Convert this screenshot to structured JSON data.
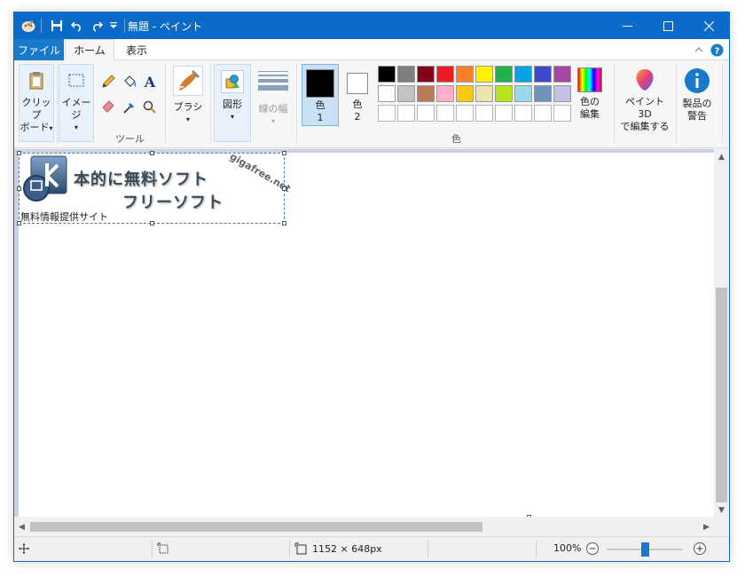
{
  "window": {
    "title": "無題 - ペイント"
  },
  "tabs": {
    "file": "ファイル",
    "home": "ホーム",
    "view": "表示"
  },
  "ribbon": {
    "clipboard": {
      "line1": "クリップ",
      "line2": "ボード"
    },
    "image": {
      "label": "イメージ"
    },
    "tools_group": "ツール",
    "brush": {
      "label": "ブラシ"
    },
    "shapes": {
      "label": "図形"
    },
    "size": {
      "label": "線の幅"
    },
    "color1": {
      "line1": "色",
      "line2": "1"
    },
    "color2": {
      "line1": "色",
      "line2": "2"
    },
    "colors_group": "色",
    "edit_colors": {
      "line1": "色の",
      "line2": "編集"
    },
    "paint3d": {
      "line1": "ペイント 3D",
      "line2": "で編集する"
    },
    "product_alert": {
      "line1": "製品の",
      "line2": "警告"
    }
  },
  "palette": {
    "row1": [
      "#000000",
      "#7f7f7f",
      "#880015",
      "#ed1c24",
      "#ff7f27",
      "#fff200",
      "#22b14c",
      "#00a2e8",
      "#3f48cc",
      "#a349a4"
    ],
    "row2": [
      "#ffffff",
      "#c3c3c3",
      "#b97a57",
      "#ffaec9",
      "#ffc90e",
      "#efe4b0",
      "#b5e61d",
      "#99d9ea",
      "#7092be",
      "#c8bfe7"
    ]
  },
  "canvas_image": {
    "line1": "本的に無料ソフト",
    "line2": "フリーソフト",
    "sub": "無料情報提供サイト",
    "url": "gigafree.net"
  },
  "status": {
    "dimensions": "1152 × 648px",
    "zoom": "100%",
    "zoom_level": 0.5
  },
  "colors": {
    "title_bar": "#0b6bc8",
    "file_tab": "#1979ca",
    "color1": "#000000",
    "color2": "#ffffff"
  }
}
